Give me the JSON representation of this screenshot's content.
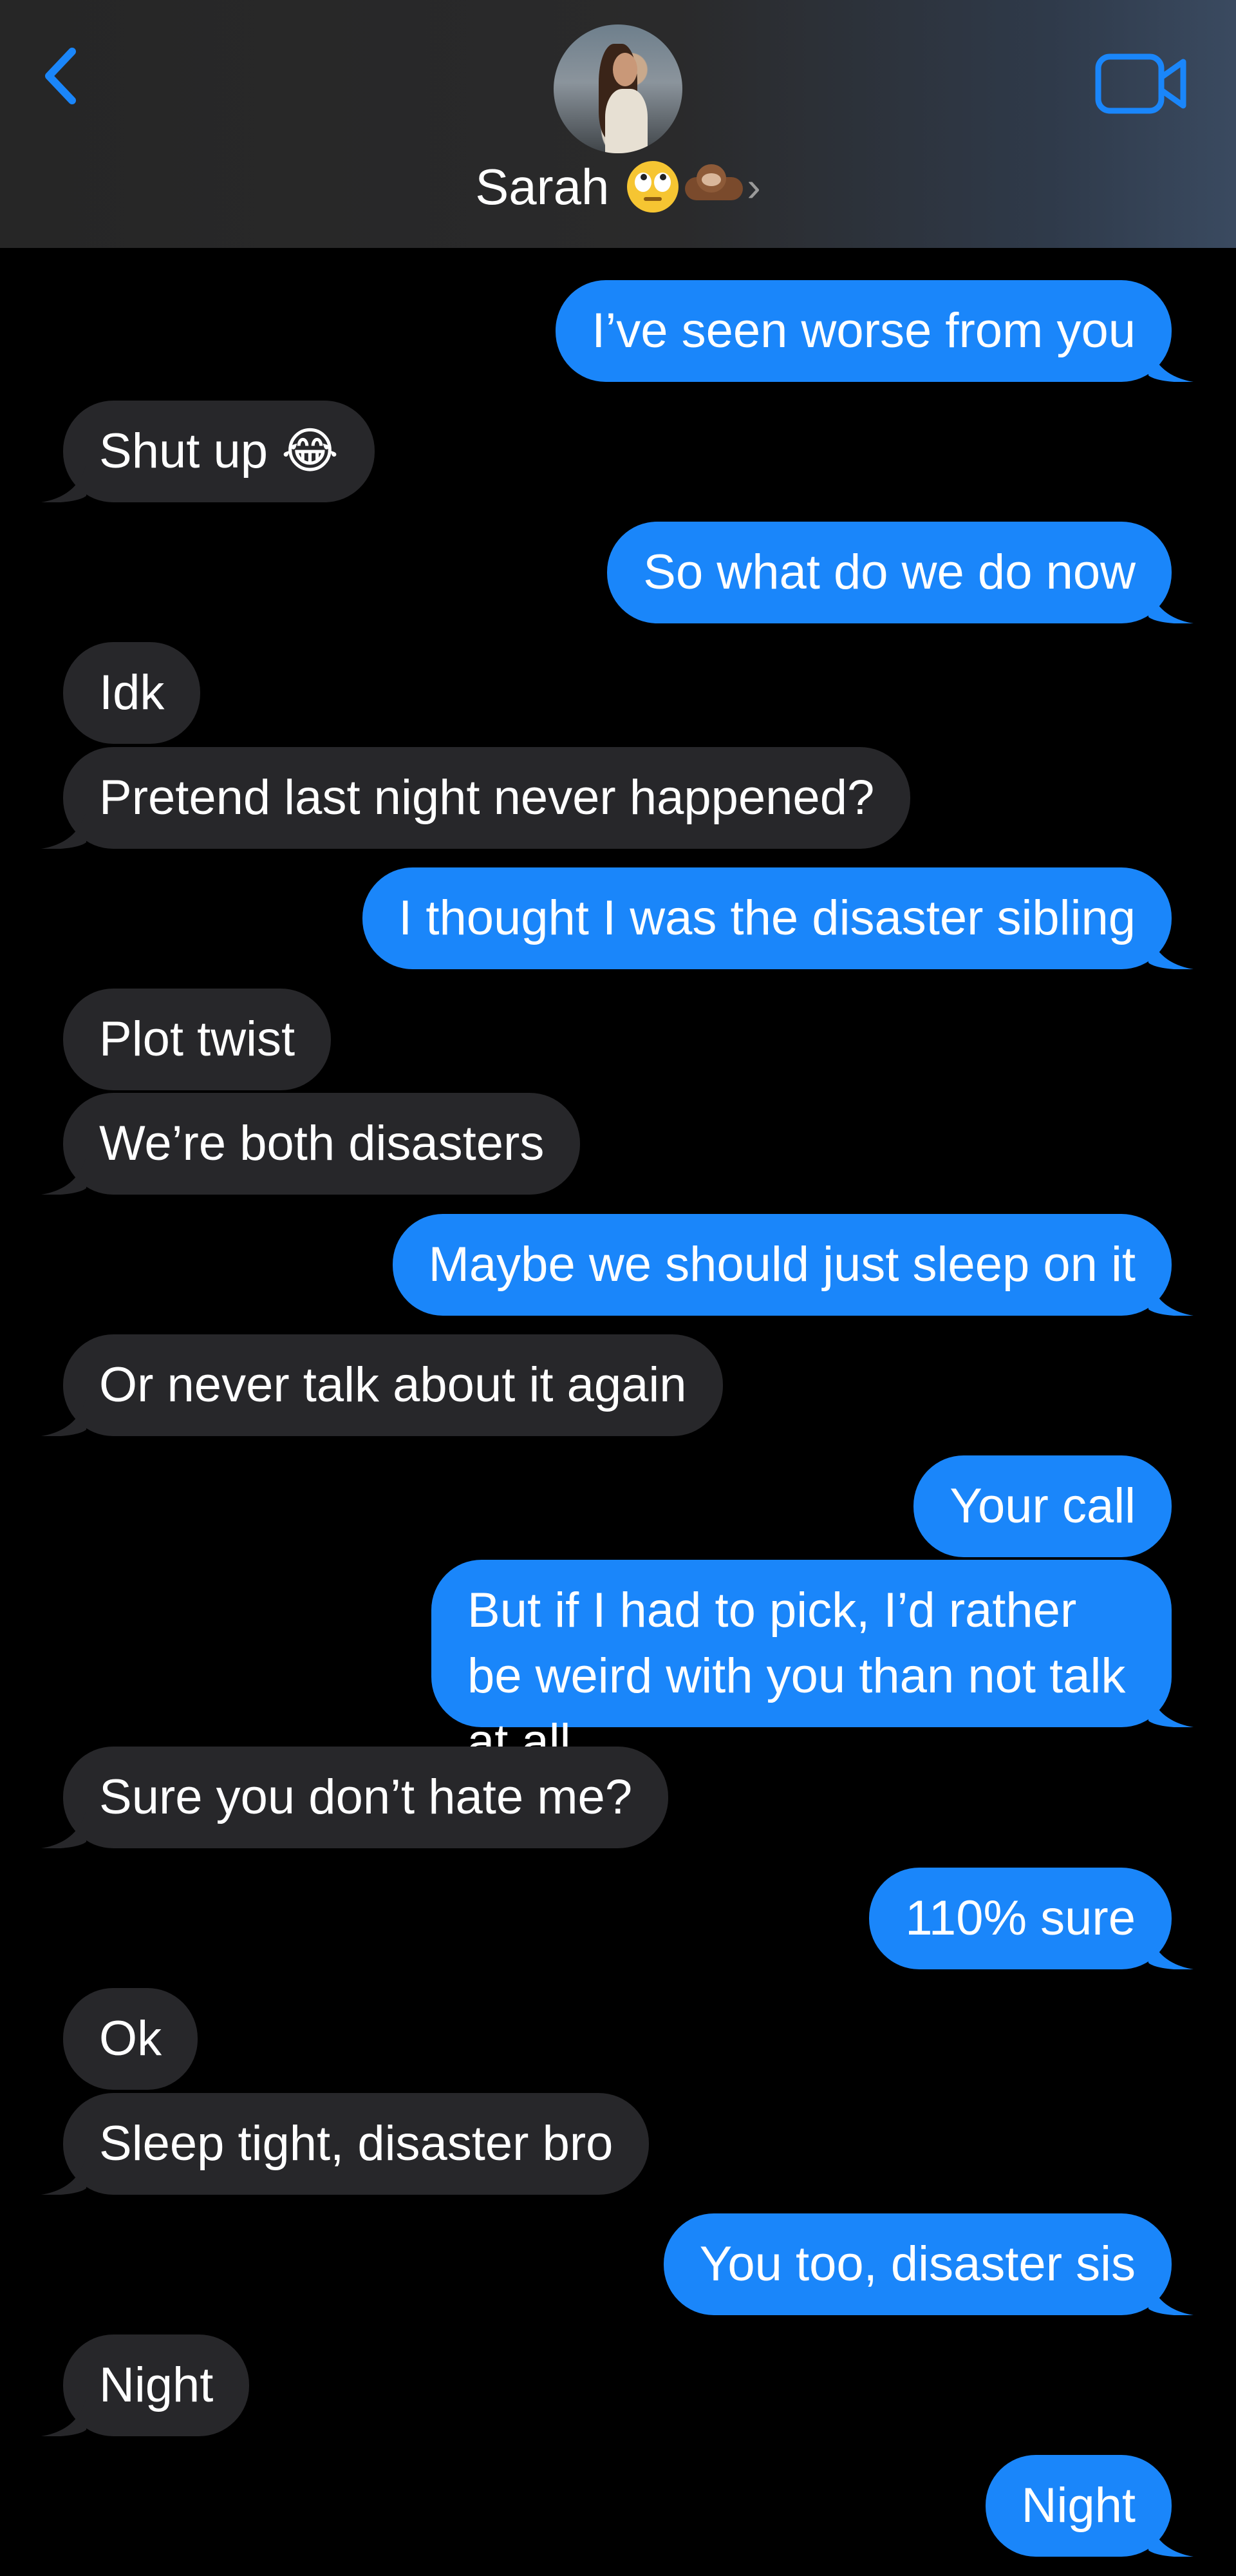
{
  "header": {
    "contact_name": "Sarah",
    "back_icon": "chevron-left-icon",
    "video_icon": "video-camera-icon",
    "emoji_1": "face-with-rolling-eyes",
    "emoji_2": "otter",
    "chevron": "›",
    "accent_color": "#1a86fa"
  },
  "messages": [
    {
      "dir": "sent",
      "text": "I’ve seen worse from you"
    },
    {
      "dir": "recv",
      "text": "Shut up 😂"
    },
    {
      "dir": "sent",
      "text": "So what do we do now"
    },
    {
      "dir": "recv",
      "text": "Idk"
    },
    {
      "dir": "recv",
      "text": "Pretend last night never happened?"
    },
    {
      "dir": "sent",
      "text": "I thought I was the disaster sibling"
    },
    {
      "dir": "recv",
      "text": "Plot twist"
    },
    {
      "dir": "recv",
      "text": "We’re both disasters"
    },
    {
      "dir": "sent",
      "text": "Maybe we should just sleep on it"
    },
    {
      "dir": "recv",
      "text": "Or never talk about it again"
    },
    {
      "dir": "sent",
      "text": "Your call"
    },
    {
      "dir": "sent",
      "text": "But if I had to pick, I’d rather be weird with you than not talk at all"
    },
    {
      "dir": "recv",
      "text": "Sure you don’t hate me?"
    },
    {
      "dir": "sent",
      "text": "110% sure"
    },
    {
      "dir": "recv",
      "text": "Ok"
    },
    {
      "dir": "recv",
      "text": "Sleep tight, disaster bro"
    },
    {
      "dir": "sent",
      "text": "You too, disaster sis"
    },
    {
      "dir": "recv",
      "text": "Night"
    },
    {
      "dir": "sent",
      "text": "Night"
    }
  ],
  "colors": {
    "sent_bubble": "#1a86fa",
    "received_bubble": "#27272a",
    "background": "#000000"
  }
}
